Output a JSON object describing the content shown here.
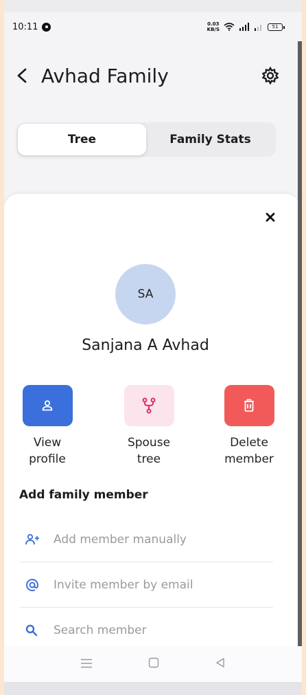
{
  "status": {
    "time": "10:11",
    "net_speed_top": "0.03",
    "net_speed_bottom": "KB/S",
    "battery": "51"
  },
  "header": {
    "title": "Avhad Family"
  },
  "tabs": [
    {
      "label": "Tree"
    },
    {
      "label": "Family Stats"
    }
  ],
  "member": {
    "initials": "SA",
    "name": "Sanjana A Avhad"
  },
  "actions": [
    {
      "label_line1": "View",
      "label_line2": "profile",
      "color": "#3a6fdc"
    },
    {
      "label_line1": "Spouse",
      "label_line2": "tree",
      "color": "#fce4ec"
    },
    {
      "label_line1": "Delete",
      "label_line2": "member",
      "color": "#f25a5a"
    }
  ],
  "add_section": {
    "title": "Add family member",
    "items": [
      {
        "label": "Add member manually",
        "icon": "add-person-icon"
      },
      {
        "label": "Invite member by email",
        "icon": "at-icon"
      },
      {
        "label": "Search member",
        "icon": "search-icon"
      }
    ]
  },
  "icons": {
    "back": "back-arrow-icon",
    "settings": "gear-icon",
    "close": "close-icon",
    "nav": [
      "menu-icon",
      "home-square-icon",
      "back-triangle-icon"
    ]
  }
}
